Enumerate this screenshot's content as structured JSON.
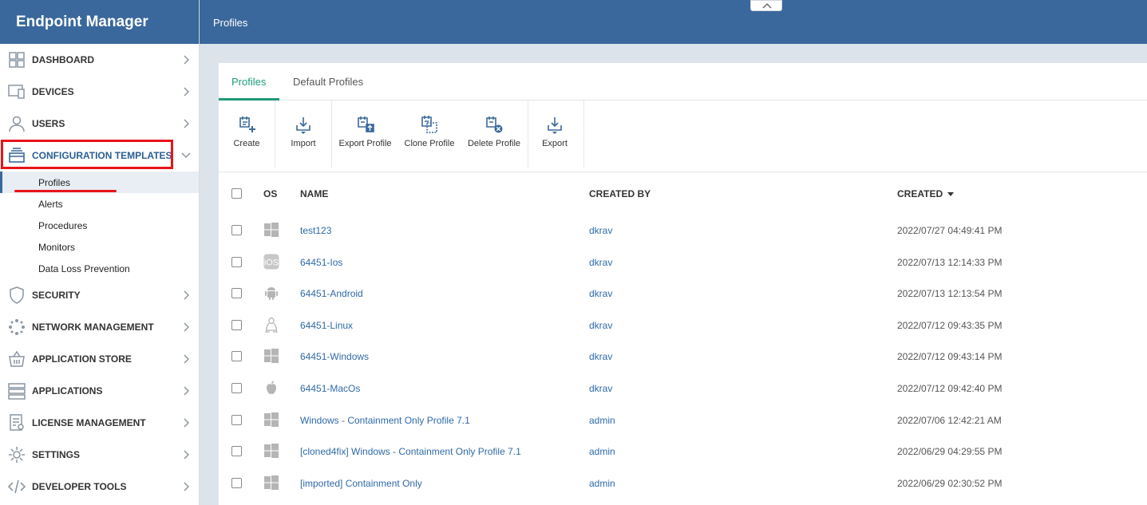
{
  "app": {
    "title": "Endpoint Manager"
  },
  "header": {
    "breadcrumb": "Profiles"
  },
  "sidebar": {
    "items": [
      {
        "label": "DASHBOARD",
        "icon": "dashboard-icon"
      },
      {
        "label": "DEVICES",
        "icon": "devices-icon"
      },
      {
        "label": "USERS",
        "icon": "user-icon"
      },
      {
        "label": "CONFIGURATION TEMPLATES",
        "icon": "templates-icon",
        "expanded": true
      },
      {
        "label": "SECURITY",
        "icon": "shield-icon"
      },
      {
        "label": "NETWORK MANAGEMENT",
        "icon": "network-icon"
      },
      {
        "label": "APPLICATION STORE",
        "icon": "store-icon"
      },
      {
        "label": "APPLICATIONS",
        "icon": "applications-icon"
      },
      {
        "label": "LICENSE MANAGEMENT",
        "icon": "license-icon"
      },
      {
        "label": "SETTINGS",
        "icon": "gear-icon"
      },
      {
        "label": "DEVELOPER TOOLS",
        "icon": "code-icon"
      }
    ],
    "subitems": [
      "Profiles",
      "Alerts",
      "Procedures",
      "Monitors",
      "Data Loss Prevention"
    ]
  },
  "tabs": [
    "Profiles",
    "Default Profiles"
  ],
  "toolbar": {
    "create": "Create",
    "import": "Import",
    "export_profile": "Export Profile",
    "clone_profile": "Clone Profile",
    "delete_profile": "Delete Profile",
    "export": "Export"
  },
  "table": {
    "columns": {
      "os": "OS",
      "name": "NAME",
      "created_by": "CREATED BY",
      "created": "CREATED"
    },
    "rows": [
      {
        "os": "windows",
        "name": "test123",
        "created_by": "dkrav",
        "created": "2022/07/27 04:49:41 PM"
      },
      {
        "os": "ios",
        "name": "64451-Ios",
        "created_by": "dkrav",
        "created": "2022/07/13 12:14:33 PM"
      },
      {
        "os": "android",
        "name": "64451-Android",
        "created_by": "dkrav",
        "created": "2022/07/13 12:13:54 PM"
      },
      {
        "os": "linux",
        "name": "64451-Linux",
        "created_by": "dkrav",
        "created": "2022/07/12 09:43:35 PM"
      },
      {
        "os": "windows",
        "name": "64451-Windows",
        "created_by": "dkrav",
        "created": "2022/07/12 09:43:14 PM"
      },
      {
        "os": "macos",
        "name": "64451-MacOs",
        "created_by": "dkrav",
        "created": "2022/07/12 09:42:40 PM"
      },
      {
        "os": "windows",
        "name": "Windows - Containment Only Profile 7.1",
        "created_by": "admin",
        "created": "2022/07/06 12:42:21 AM"
      },
      {
        "os": "windows",
        "name": "[cloned4fix] Windows - Containment Only Profile 7.1",
        "created_by": "admin",
        "created": "2022/06/29 04:29:55 PM"
      },
      {
        "os": "windows",
        "name": "[imported] Containment Only",
        "created_by": "admin",
        "created": "2022/06/29 02:30:52 PM"
      }
    ]
  },
  "colors": {
    "header": "#3a689c",
    "accent": "#1f9b7a",
    "link": "#2f6aa8",
    "highlight": "#e8141b"
  }
}
